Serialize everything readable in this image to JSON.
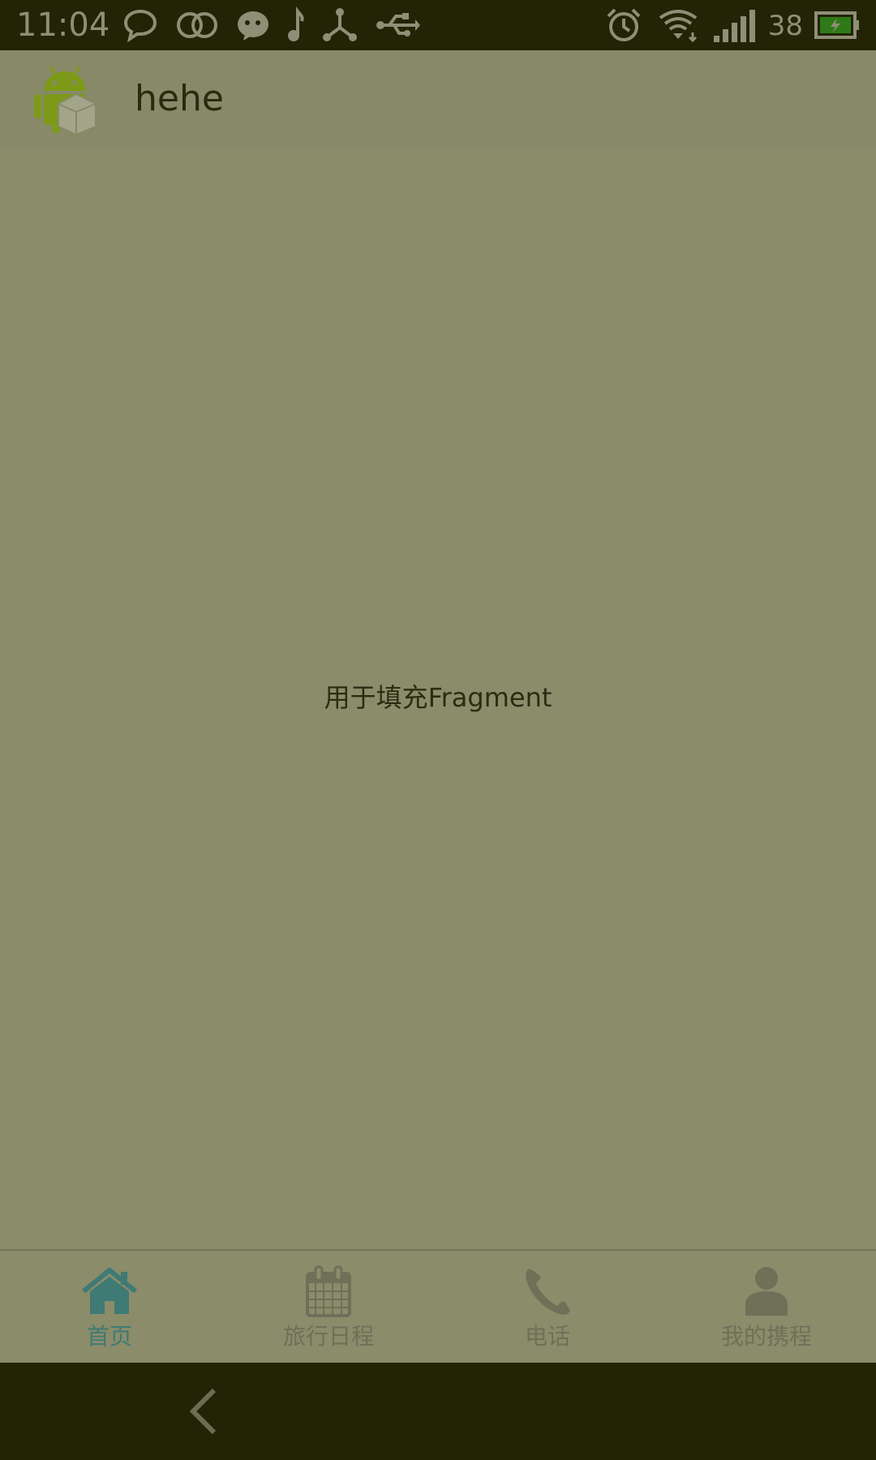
{
  "status_bar": {
    "time": "11:04",
    "battery_level": "38",
    "left_icons": [
      "chat-bubble-icon",
      "overlapping-circles-icon",
      "wechat-icon",
      "music-note-icon",
      "share-hub-icon",
      "usb-icon"
    ],
    "right_icons": [
      "alarm-clock-icon",
      "wifi-icon",
      "signal-bars-icon",
      "battery-charging-icon"
    ]
  },
  "action_bar": {
    "title": "hehe",
    "logo_icon": "android-box-icon"
  },
  "content": {
    "placeholder": "用于填充Fragment"
  },
  "tabs": [
    {
      "label": "首页",
      "icon": "home-icon",
      "active": true
    },
    {
      "label": "旅行日程",
      "icon": "calendar-icon",
      "active": false
    },
    {
      "label": "电话",
      "icon": "phone-icon",
      "active": false
    },
    {
      "label": "我的携程",
      "icon": "person-icon",
      "active": false
    }
  ],
  "nav_bar": {
    "back_icon": "back-chevron-icon"
  },
  "colors": {
    "status_bar_bg": "#232305",
    "background": "#8a8c6a",
    "tab_active": "#3f7a74",
    "tab_inactive": "#6e7058"
  }
}
